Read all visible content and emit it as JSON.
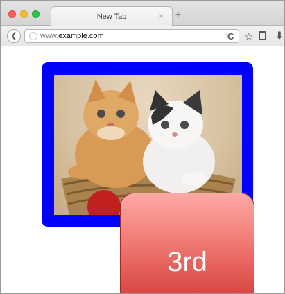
{
  "browser": {
    "tab_title": "New Tab",
    "tab_close": "×",
    "new_tab": "+",
    "url_prefix": "www.",
    "url_domain": "example.com",
    "toolbar_icons": [
      "back-arrow-icon",
      "globe-icon",
      "reload-icon",
      "star-icon",
      "clipboard-icon",
      "download-icon"
    ]
  },
  "page": {
    "image_alt_subject": "two kittens in a wicker basket",
    "frame_color": "#0000ff",
    "badge_label": "3rd",
    "badge_color": "#f27c76"
  }
}
